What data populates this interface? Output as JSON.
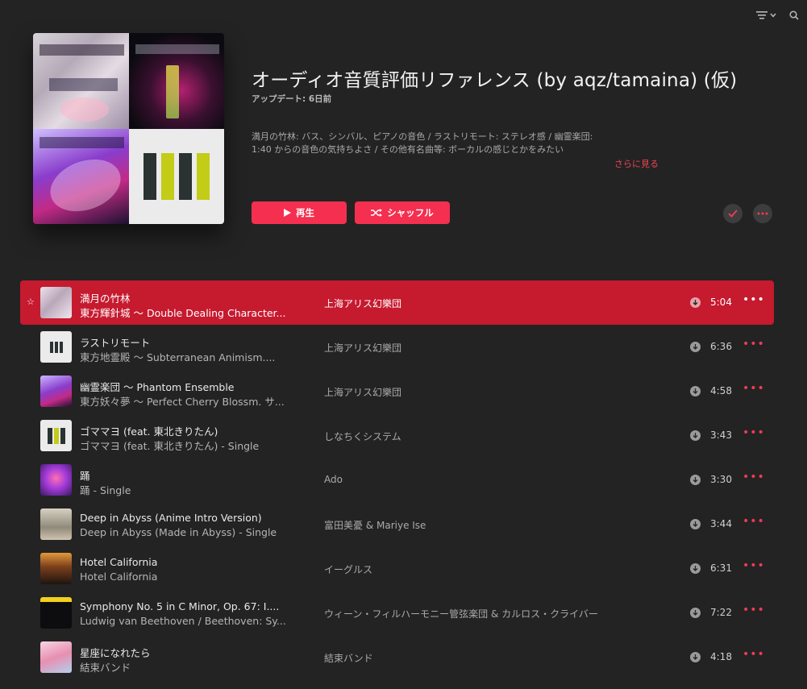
{
  "playlist": {
    "title": "オーディオ音質評価リファレンス (by aqz/tamaina) (仮)",
    "updated": "アップデート: 6日前",
    "description": "満月の竹林: バス、シンバル、ピアノの音色 / ラストリモート: ステレオ感 / 幽霊楽団: 1:40 からの音色の気持ちよさ / その他有名曲等: ボーカルの感じとかをみたい",
    "more_link": "さらに見る",
    "play_label": "再生",
    "shuffle_label": "シャッフル"
  },
  "icons": {
    "sort": "sort-lines-icon",
    "search": "search-icon",
    "play": "play-icon",
    "shuffle": "shuffle-icon",
    "check": "check-icon",
    "more": "more-dots-icon",
    "download": "download-icon",
    "favorite": "star-icon"
  },
  "colors": {
    "accent": "#f42f4f",
    "active_row": "#c61a2f",
    "background": "#232323"
  },
  "tracks": [
    {
      "name": "満月の竹林",
      "album": "東方輝針城 〜 Double Dealing Character...",
      "artist": "上海アリス幻樂団",
      "duration": "5:04",
      "active": true,
      "favorite": true
    },
    {
      "name": "ラストリモート",
      "album": "東方地霊殿 〜 Subterranean Animism....",
      "artist": "上海アリス幻樂団",
      "duration": "6:36"
    },
    {
      "name": "幽霊楽団 〜 Phantom Ensemble",
      "album": "東方妖々夢 〜 Perfect Cherry Blossm. サ...",
      "artist": "上海アリス幻樂団",
      "duration": "4:58"
    },
    {
      "name": "ゴママヨ (feat. 東北きりたん)",
      "album": "ゴママヨ (feat. 東北きりたん) - Single",
      "artist": "しなちくシステム",
      "duration": "3:43"
    },
    {
      "name": "踊",
      "album": "踊 - Single",
      "artist": "Ado",
      "duration": "3:30"
    },
    {
      "name": "Deep in Abyss (Anime Intro Version)",
      "album": "Deep in Abyss (Made in Abyss) - Single",
      "artist": "富田美憂 & Mariye Ise",
      "duration": "3:44"
    },
    {
      "name": "Hotel California",
      "album": "Hotel California",
      "artist": "イーグルス",
      "duration": "6:31"
    },
    {
      "name": "Symphony No. 5 in C Minor, Op. 67: I....",
      "album": "Ludwig van Beethoven / Beethoven: Sy...",
      "artist": "ウィーン・フィルハーモニー管弦楽団 & カルロス・クライバー",
      "duration": "7:22"
    },
    {
      "name": "星座になれたら",
      "album": "結束バンド",
      "artist": "結束バンド",
      "duration": "4:18"
    }
  ]
}
